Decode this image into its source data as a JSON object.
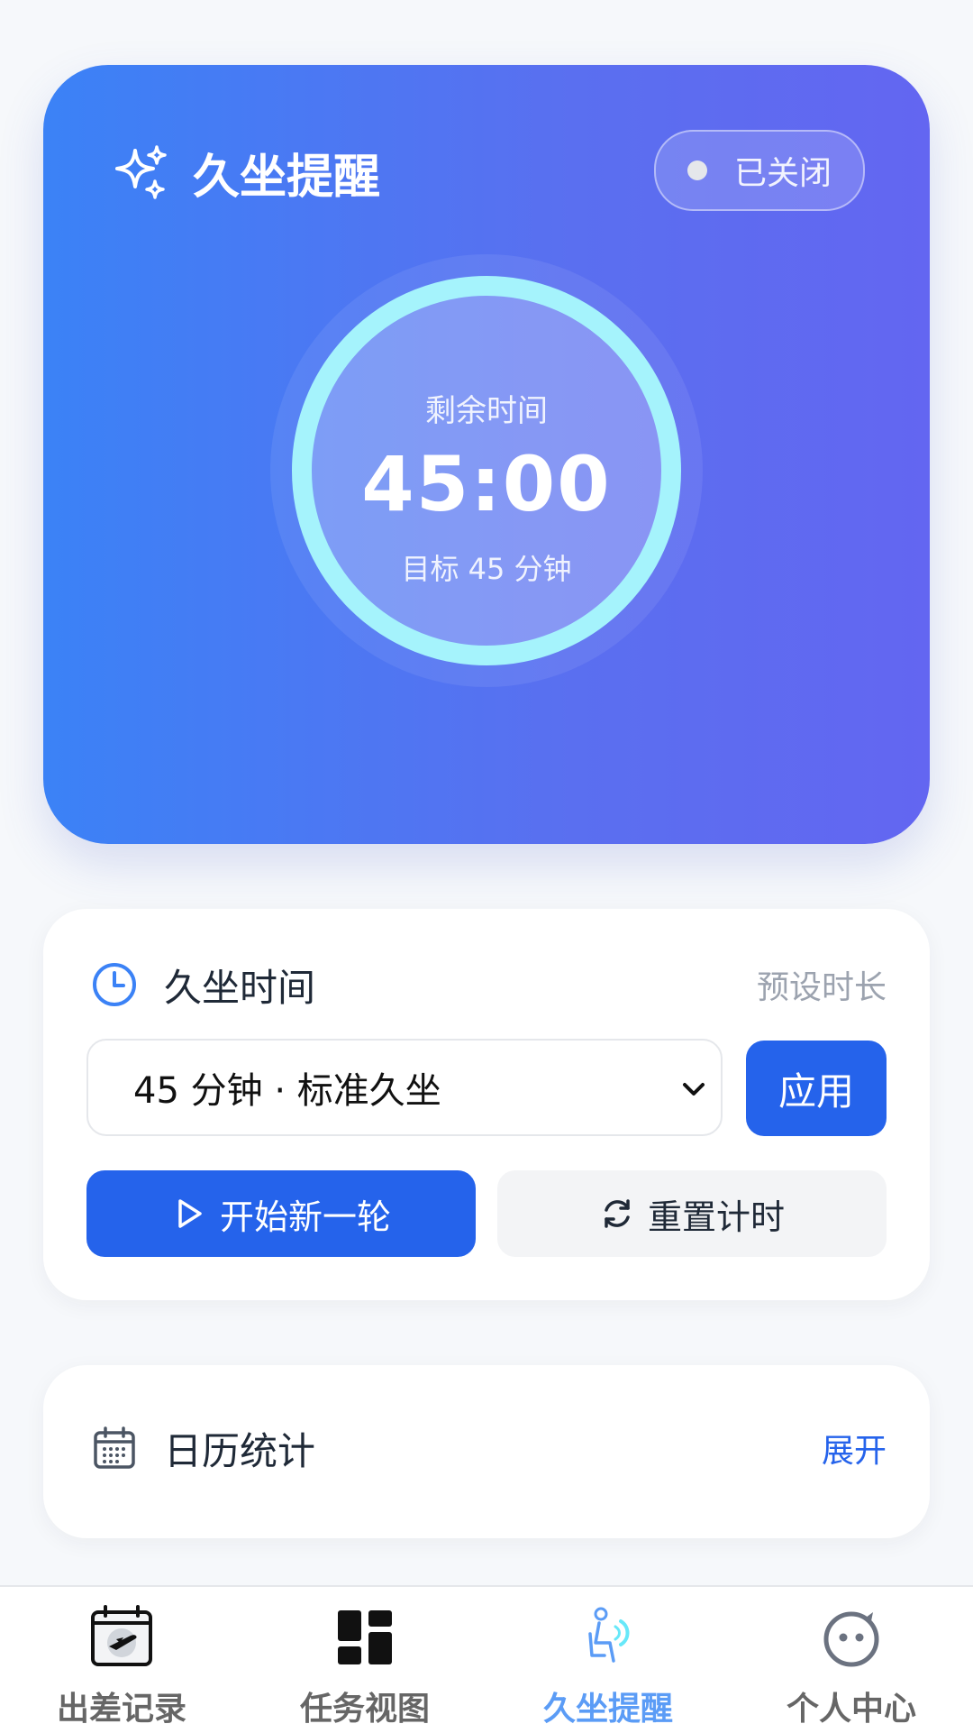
{
  "hero": {
    "title": "久坐提醒",
    "status_label": "已关闭",
    "timer_label": "剩余时间",
    "timer_value": "45:00",
    "timer_target": "目标 45 分钟"
  },
  "settings": {
    "title": "久坐时间",
    "note": "预设时长",
    "selected_option": "45 分钟 · 标准久坐",
    "apply_label": "应用",
    "start_label": "开始新一轮",
    "reset_label": "重置计时"
  },
  "calendar": {
    "title": "日历统计",
    "expand_label": "展开"
  },
  "nav": {
    "items": [
      {
        "label": "出差记录",
        "icon": "travel-calendar-icon"
      },
      {
        "label": "任务视图",
        "icon": "dashboard-grid-icon"
      },
      {
        "label": "久坐提醒",
        "icon": "sitting-person-icon",
        "active": true
      },
      {
        "label": "个人中心",
        "icon": "profile-face-icon"
      }
    ]
  },
  "colors": {
    "primary": "#2563eb",
    "gradient_start": "#3b82f6",
    "gradient_end": "#6366f1",
    "ring": "#a5f3fc",
    "active_nav": "#5b9cf6"
  }
}
